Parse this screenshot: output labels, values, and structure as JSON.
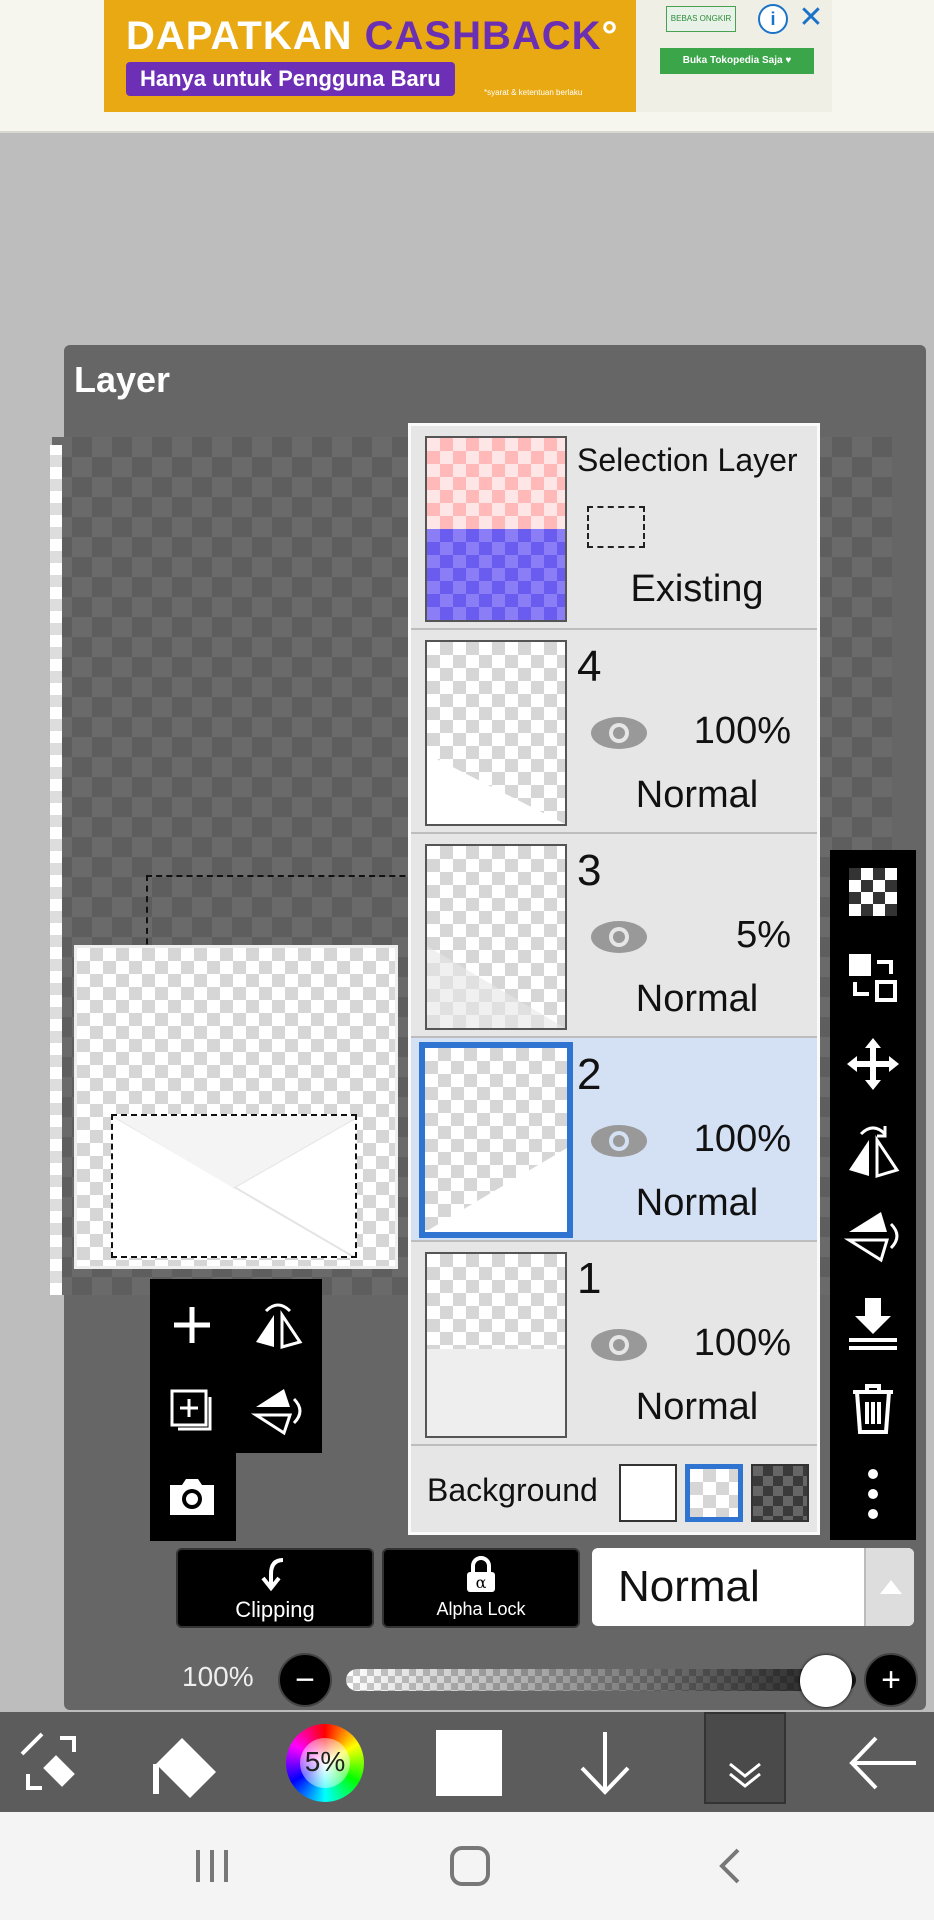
{
  "ad": {
    "title_part1": "DAPATKAN ",
    "title_part2": "CASHBACK",
    "title_mark": "°",
    "subtitle": "Hanya untuk Pengguna Baru",
    "fineprint": "*syarat & ketentuan berlaku",
    "logo_text": "BEBAS ONGKIR",
    "cta": "Buka Tokopedia Saja ♥",
    "info": "i",
    "close": "✕"
  },
  "panel": {
    "title": "Layer"
  },
  "layers": {
    "selection": {
      "name": "Selection Layer",
      "status": "Existing"
    },
    "items": [
      {
        "name": "4",
        "opacity": "100%",
        "mode": "Normal",
        "selected": false
      },
      {
        "name": "3",
        "opacity": "5%",
        "mode": "Normal",
        "selected": false
      },
      {
        "name": "2",
        "opacity": "100%",
        "mode": "Normal",
        "selected": true
      },
      {
        "name": "1",
        "opacity": "100%",
        "mode": "Normal",
        "selected": false
      }
    ],
    "background_label": "Background"
  },
  "controls": {
    "clipping_label": "Clipping",
    "alpha_lock_label": "Alpha Lock",
    "blend_mode": "Normal",
    "opacity_pct": "100%",
    "opacity_value": 1.0,
    "minus": "−",
    "plus": "+"
  },
  "bottom_toolbar": {
    "color_opacity": "5%"
  },
  "icons": {
    "right_toolbar": [
      "checker-icon",
      "layer-swap-icon",
      "move-icon",
      "flip-horizontal-icon",
      "flip-vertical-icon",
      "merge-down-icon",
      "trash-icon",
      "more-vertical-icon"
    ],
    "left_toolbar": [
      "add-layer-icon",
      "flip-layer-horizontal-icon",
      "add-copy-layer-icon",
      "flip-layer-vertical-icon",
      "camera-icon"
    ],
    "bottom_toolbar": [
      "transform-tool-icon",
      "eraser-shape-icon",
      "color-wheel-icon",
      "color-swatch-icon",
      "down-arrow-icon",
      "collapse-icon",
      "back-arrow-icon"
    ]
  }
}
